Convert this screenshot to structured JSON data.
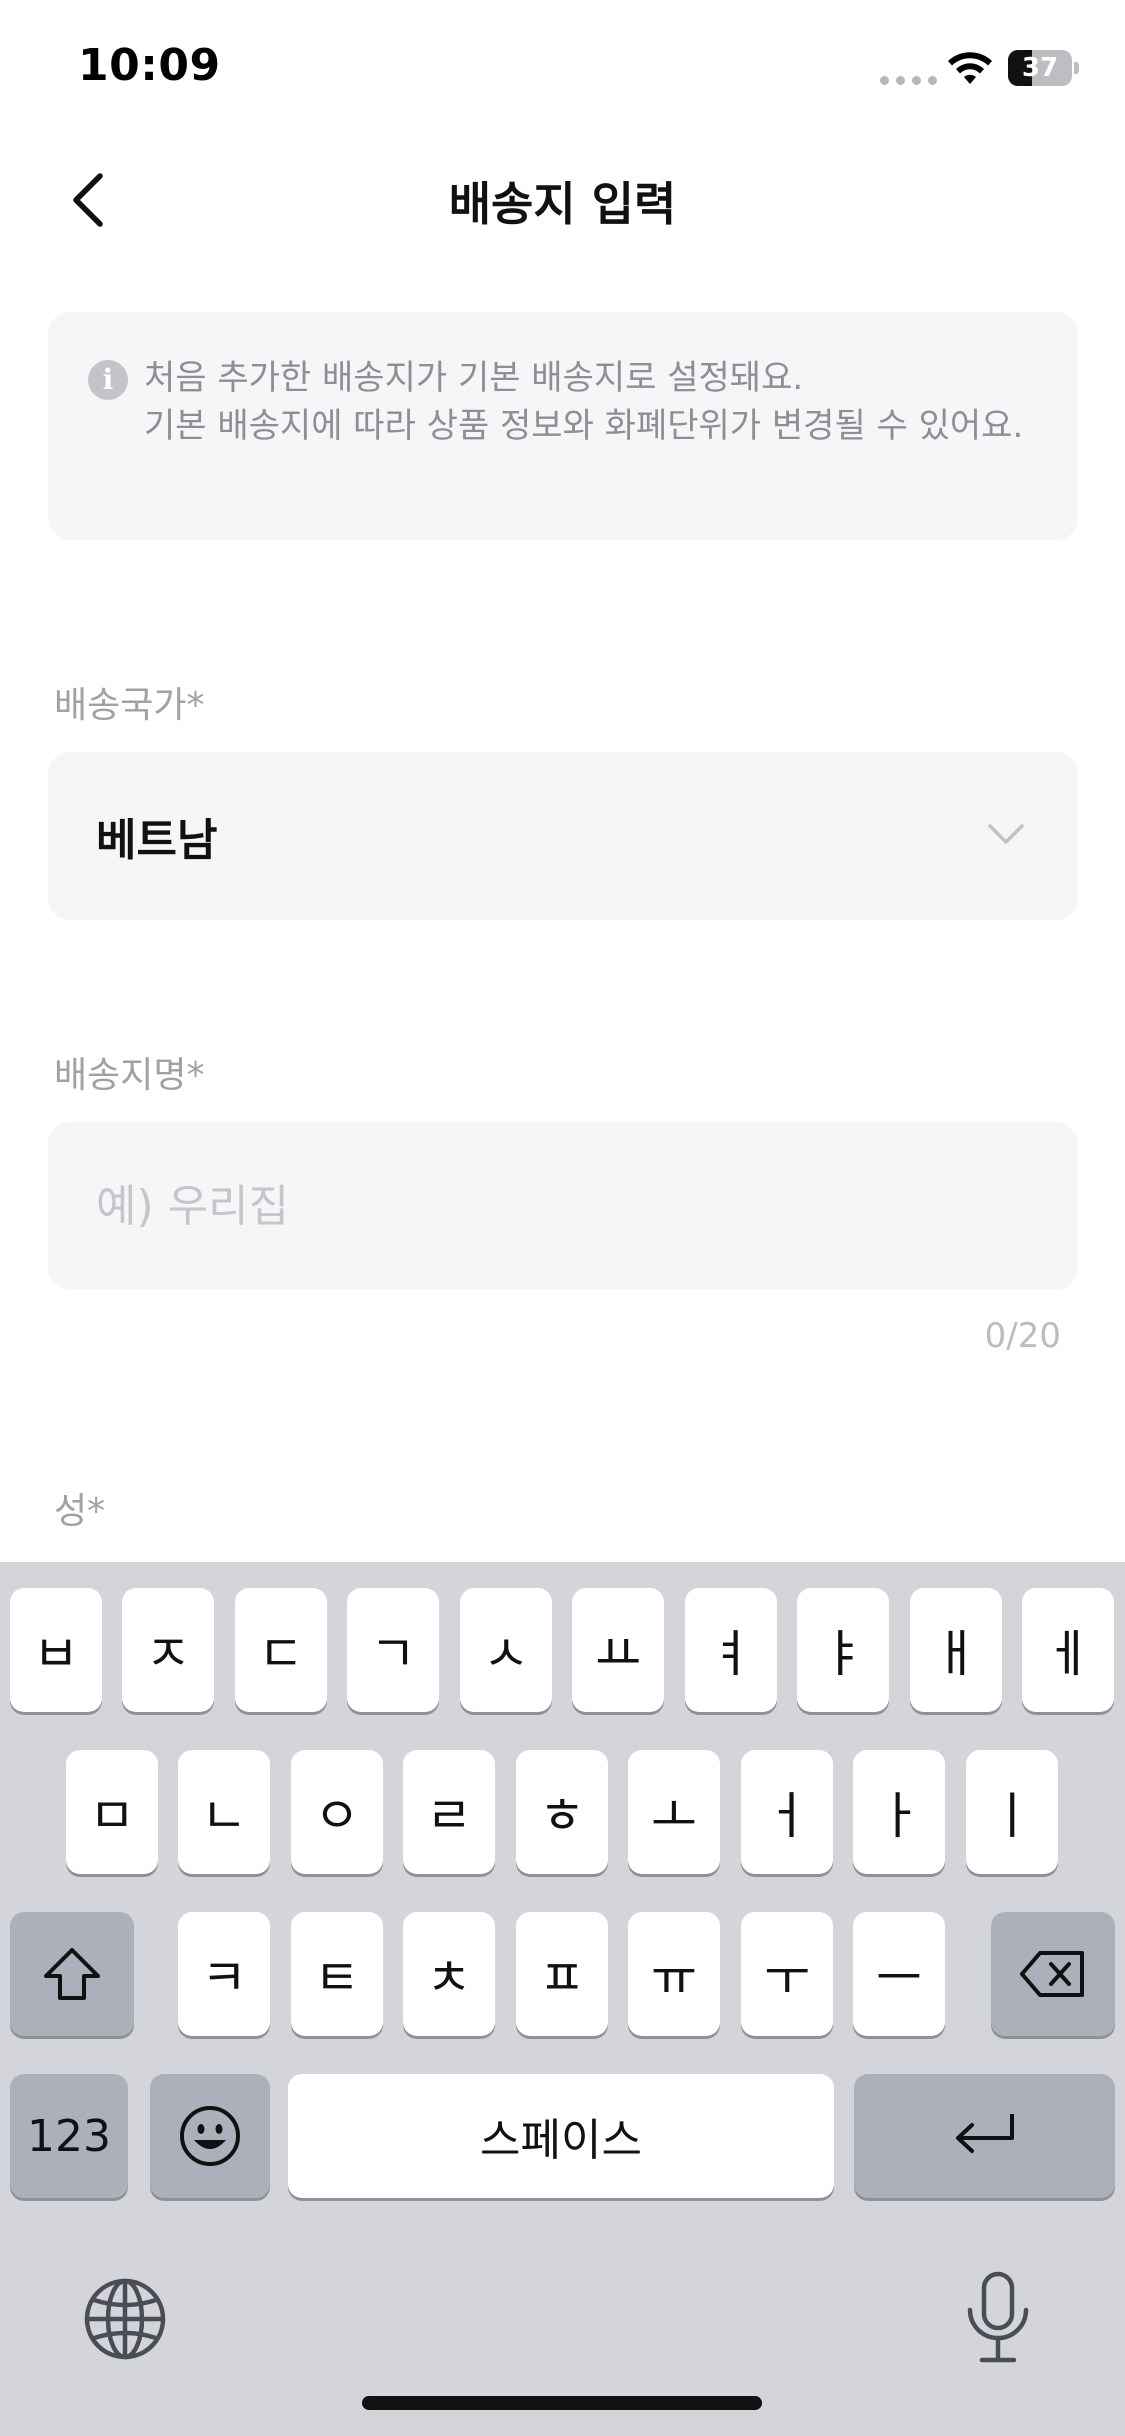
{
  "status_bar": {
    "time": "10:09",
    "battery_percent": "37",
    "battery_level": 0.37
  },
  "nav": {
    "title": "배송지 입력"
  },
  "notice": {
    "icon": "info-icon",
    "icon_glyph": "i",
    "line1": "처음 추가한 배송지가 기본 배송지로 설정돼요.",
    "line2": "기본 배송지에 따라 상품 정보와 화폐단위가 변경될 수 있어요."
  },
  "country_field": {
    "label": "배송국가*",
    "value": "베트남"
  },
  "name_field": {
    "label": "배송지명*",
    "placeholder": "예) 우리집",
    "value": "",
    "counter": "0/20"
  },
  "surname_field": {
    "label": "성*"
  },
  "keyboard": {
    "row1": [
      "ㅂ",
      "ㅈ",
      "ㄷ",
      "ㄱ",
      "ㅅ",
      "ㅛ",
      "ㅕ",
      "ㅑ",
      "ㅐ",
      "ㅔ"
    ],
    "row2": [
      "ㅁ",
      "ㄴ",
      "ㅇ",
      "ㄹ",
      "ㅎ",
      "ㅗ",
      "ㅓ",
      "ㅏ",
      "ㅣ"
    ],
    "row3": [
      "ㅋ",
      "ㅌ",
      "ㅊ",
      "ㅍ",
      "ㅠ",
      "ㅜ",
      "ㅡ"
    ],
    "numbers_key": "123",
    "space_key": "스페이스",
    "shift_icon": "shift-icon",
    "delete_icon": "delete-icon",
    "emoji_icon": "emoji-icon",
    "return_icon": "return-icon",
    "globe_icon": "globe-icon",
    "mic_icon": "microphone-icon"
  }
}
